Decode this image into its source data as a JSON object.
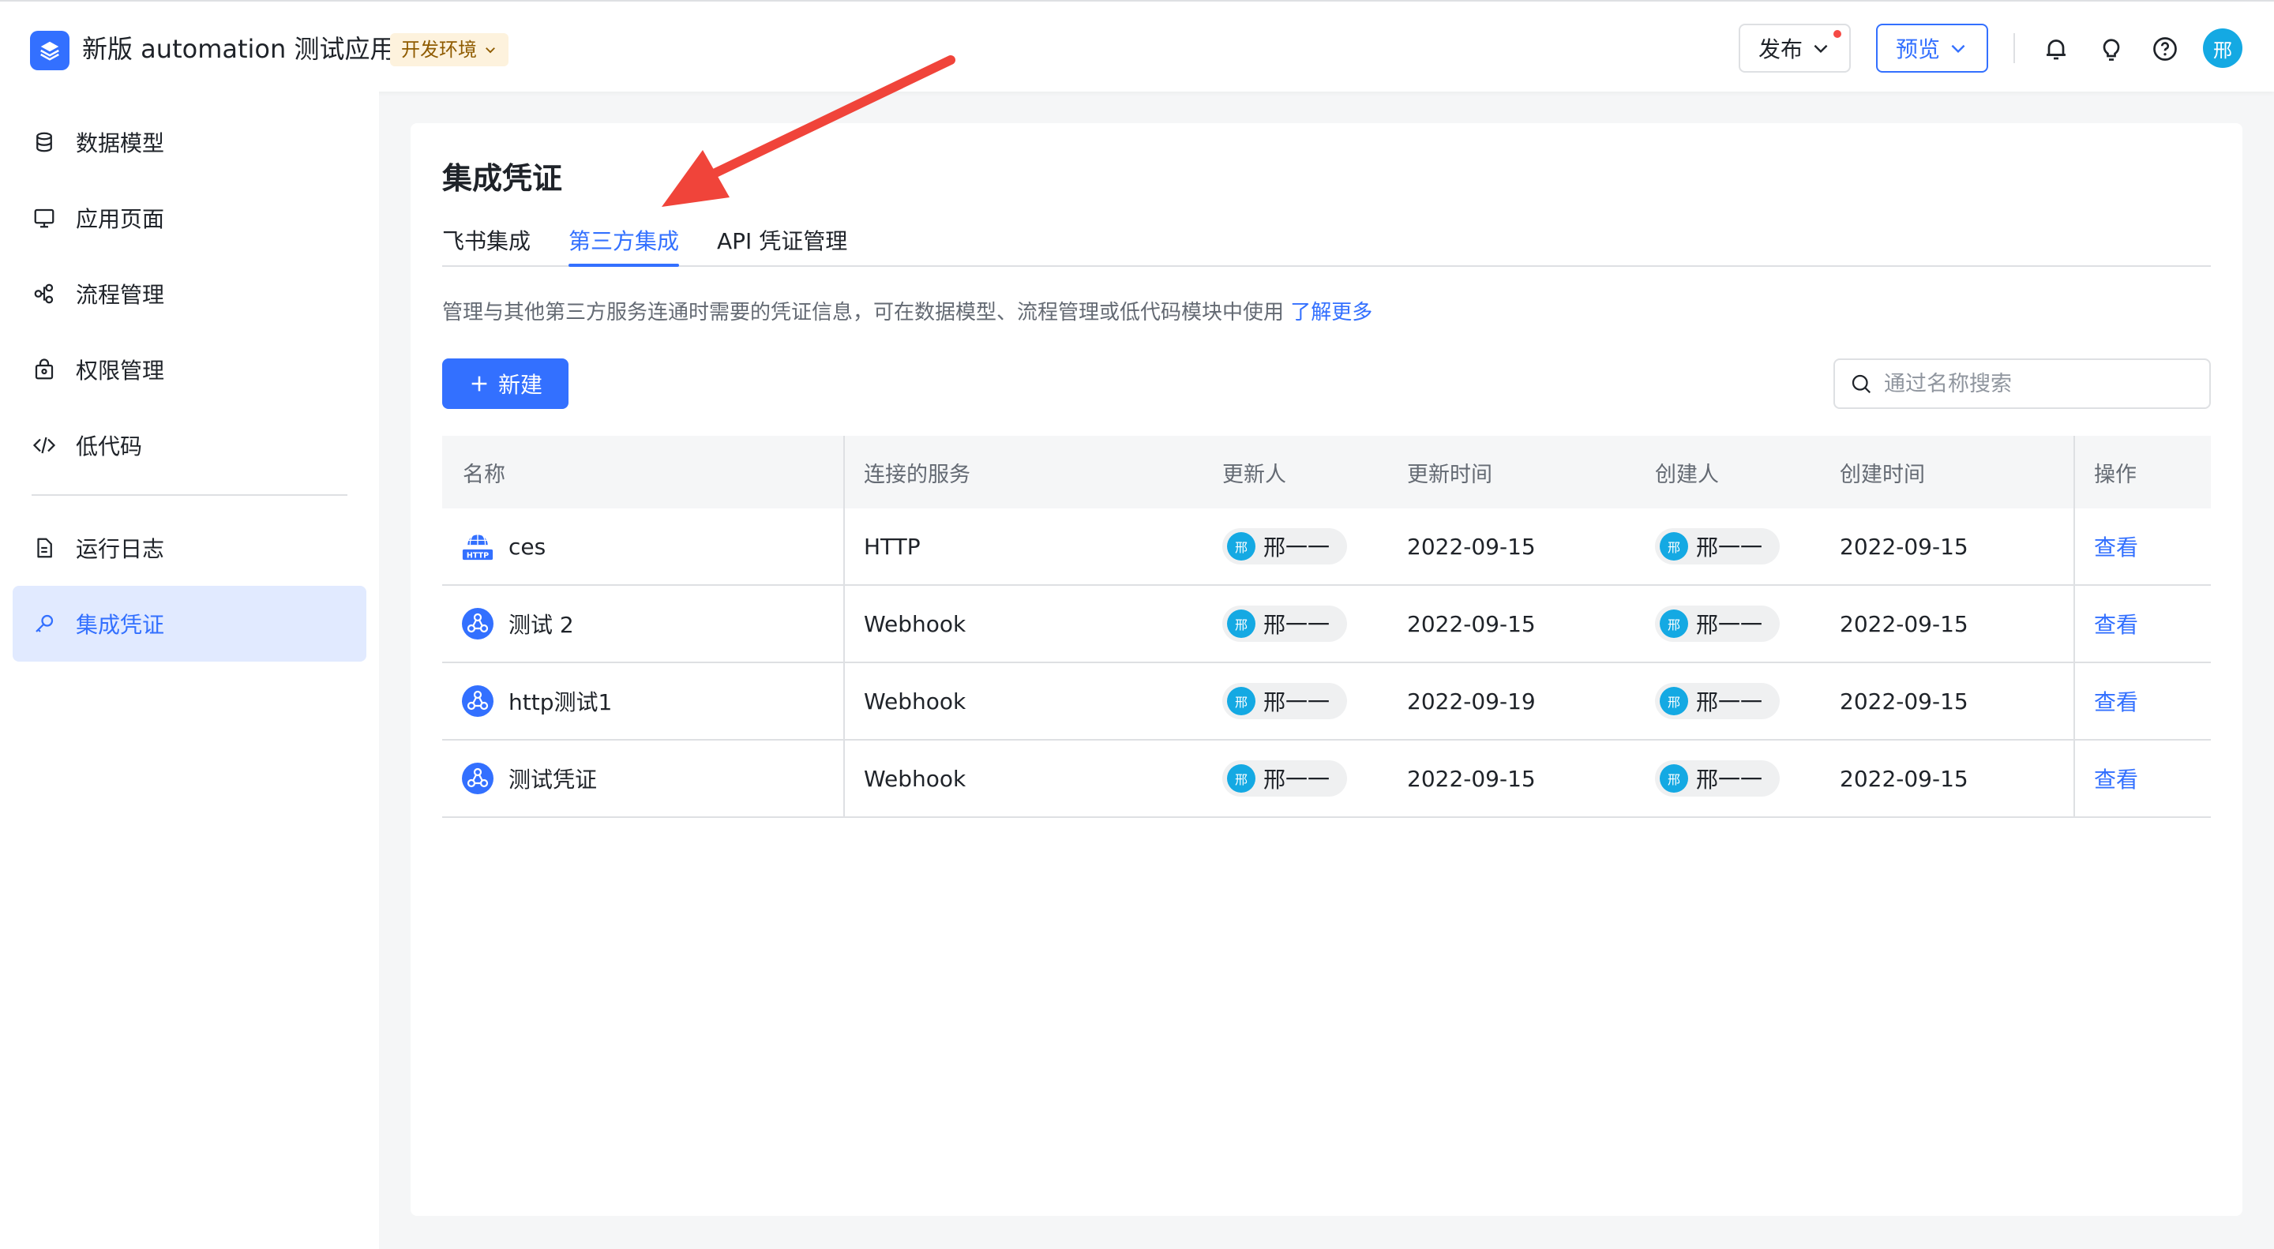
{
  "header": {
    "app_title": "新版 automation 测试应用",
    "env_badge": "开发环境",
    "publish_label": "发布",
    "preview_label": "预览",
    "user_initial": "邢",
    "icons": [
      "bell-icon",
      "lightbulb-icon",
      "help-icon"
    ]
  },
  "sidebar": {
    "items": [
      {
        "label": "数据模型",
        "icon": "database-icon"
      },
      {
        "label": "应用页面",
        "icon": "monitor-icon"
      },
      {
        "label": "流程管理",
        "icon": "flow-icon"
      },
      {
        "label": "权限管理",
        "icon": "lock-bag-icon"
      },
      {
        "label": "低代码",
        "icon": "code-icon"
      },
      {
        "label": "运行日志",
        "icon": "log-icon"
      },
      {
        "label": "集成凭证",
        "icon": "key-icon",
        "active": true
      }
    ]
  },
  "main": {
    "title": "集成凭证",
    "tabs": [
      {
        "label": "飞书集成"
      },
      {
        "label": "第三方集成",
        "active": true
      },
      {
        "label": "API 凭证管理"
      }
    ],
    "description": "管理与其他第三方服务连通时需要的凭证信息，可在数据模型、流程管理或低代码模块中使用",
    "learn_more": "了解更多",
    "new_button": "新建",
    "search_placeholder": "通过名称搜索",
    "table": {
      "columns": [
        "名称",
        "连接的服务",
        "更新人",
        "更新时间",
        "创建人",
        "创建时间",
        "操作"
      ],
      "rows": [
        {
          "name": "ces",
          "icon": "http-icon",
          "service": "HTTP",
          "updater": "邢一一",
          "updated": "2022-09-15",
          "creator": "邢一一",
          "created": "2022-09-15",
          "action": "查看"
        },
        {
          "name": "测试 2",
          "icon": "webhook-icon",
          "service": "Webhook",
          "updater": "邢一一",
          "updated": "2022-09-15",
          "creator": "邢一一",
          "created": "2022-09-15",
          "action": "查看"
        },
        {
          "name": "http测试1",
          "icon": "webhook-icon",
          "service": "Webhook",
          "updater": "邢一一",
          "updated": "2022-09-19",
          "creator": "邢一一",
          "created": "2022-09-15",
          "action": "查看"
        },
        {
          "name": "测试凭证",
          "icon": "webhook-icon",
          "service": "Webhook",
          "updater": "邢一一",
          "updated": "2022-09-15",
          "creator": "邢一一",
          "created": "2022-09-15",
          "action": "查看"
        }
      ]
    }
  },
  "colors": {
    "accent": "#3370ff",
    "annotation": "#f0443a",
    "avatar": "#14a9e3"
  }
}
